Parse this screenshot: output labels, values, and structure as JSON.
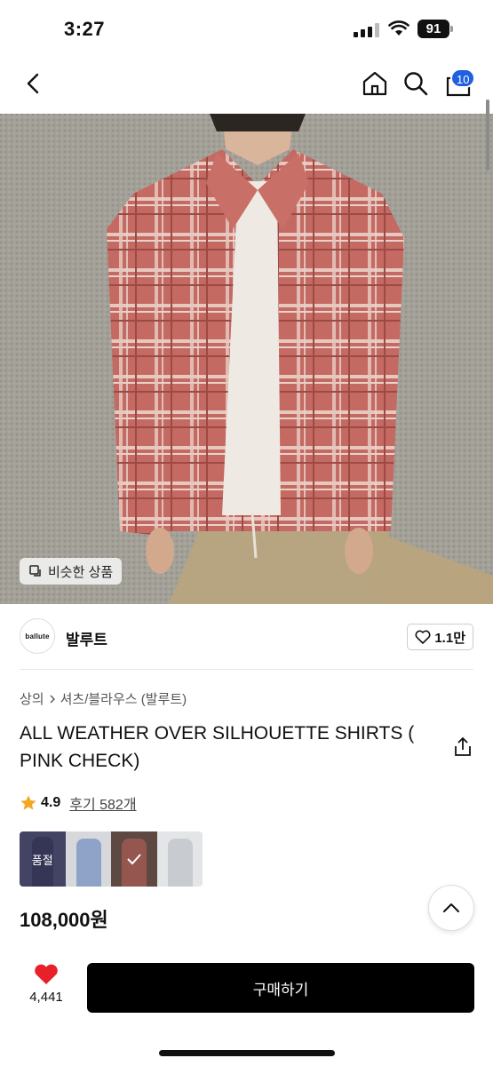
{
  "status_bar": {
    "time": "3:27",
    "battery": "91"
  },
  "header": {
    "cart_count": "10"
  },
  "hero": {
    "similar_label": "비슷한 상품"
  },
  "brand": {
    "logo_text": "ballute",
    "name": "발루트",
    "likes": "1.1만"
  },
  "breadcrumb": [
    "상의",
    "셔츠/블라우스 (발루트)"
  ],
  "product": {
    "title": "ALL WEATHER OVER SILHOUETTE SHIRTS ( PINK CHECK)",
    "rating": "4.9",
    "reviews": "후기 582개",
    "price": "108,000원"
  },
  "color_options": [
    {
      "name": "navy",
      "status": "품절",
      "color": "#5d5f8a"
    },
    {
      "name": "blue-check",
      "status": "",
      "color": "#8fa3c8"
    },
    {
      "name": "pink-check",
      "status": "selected",
      "color": "#8a5a52"
    },
    {
      "name": "grey",
      "status": "",
      "color": "#c8cbd0"
    }
  ],
  "bottom_bar": {
    "wish_count": "4,441",
    "buy_label": "구매하기"
  },
  "colors": {
    "accent_blue": "#1f5fe0",
    "heart_red": "#e8202a",
    "star": "#f5a623",
    "shirt_pink": "#c8625c"
  }
}
